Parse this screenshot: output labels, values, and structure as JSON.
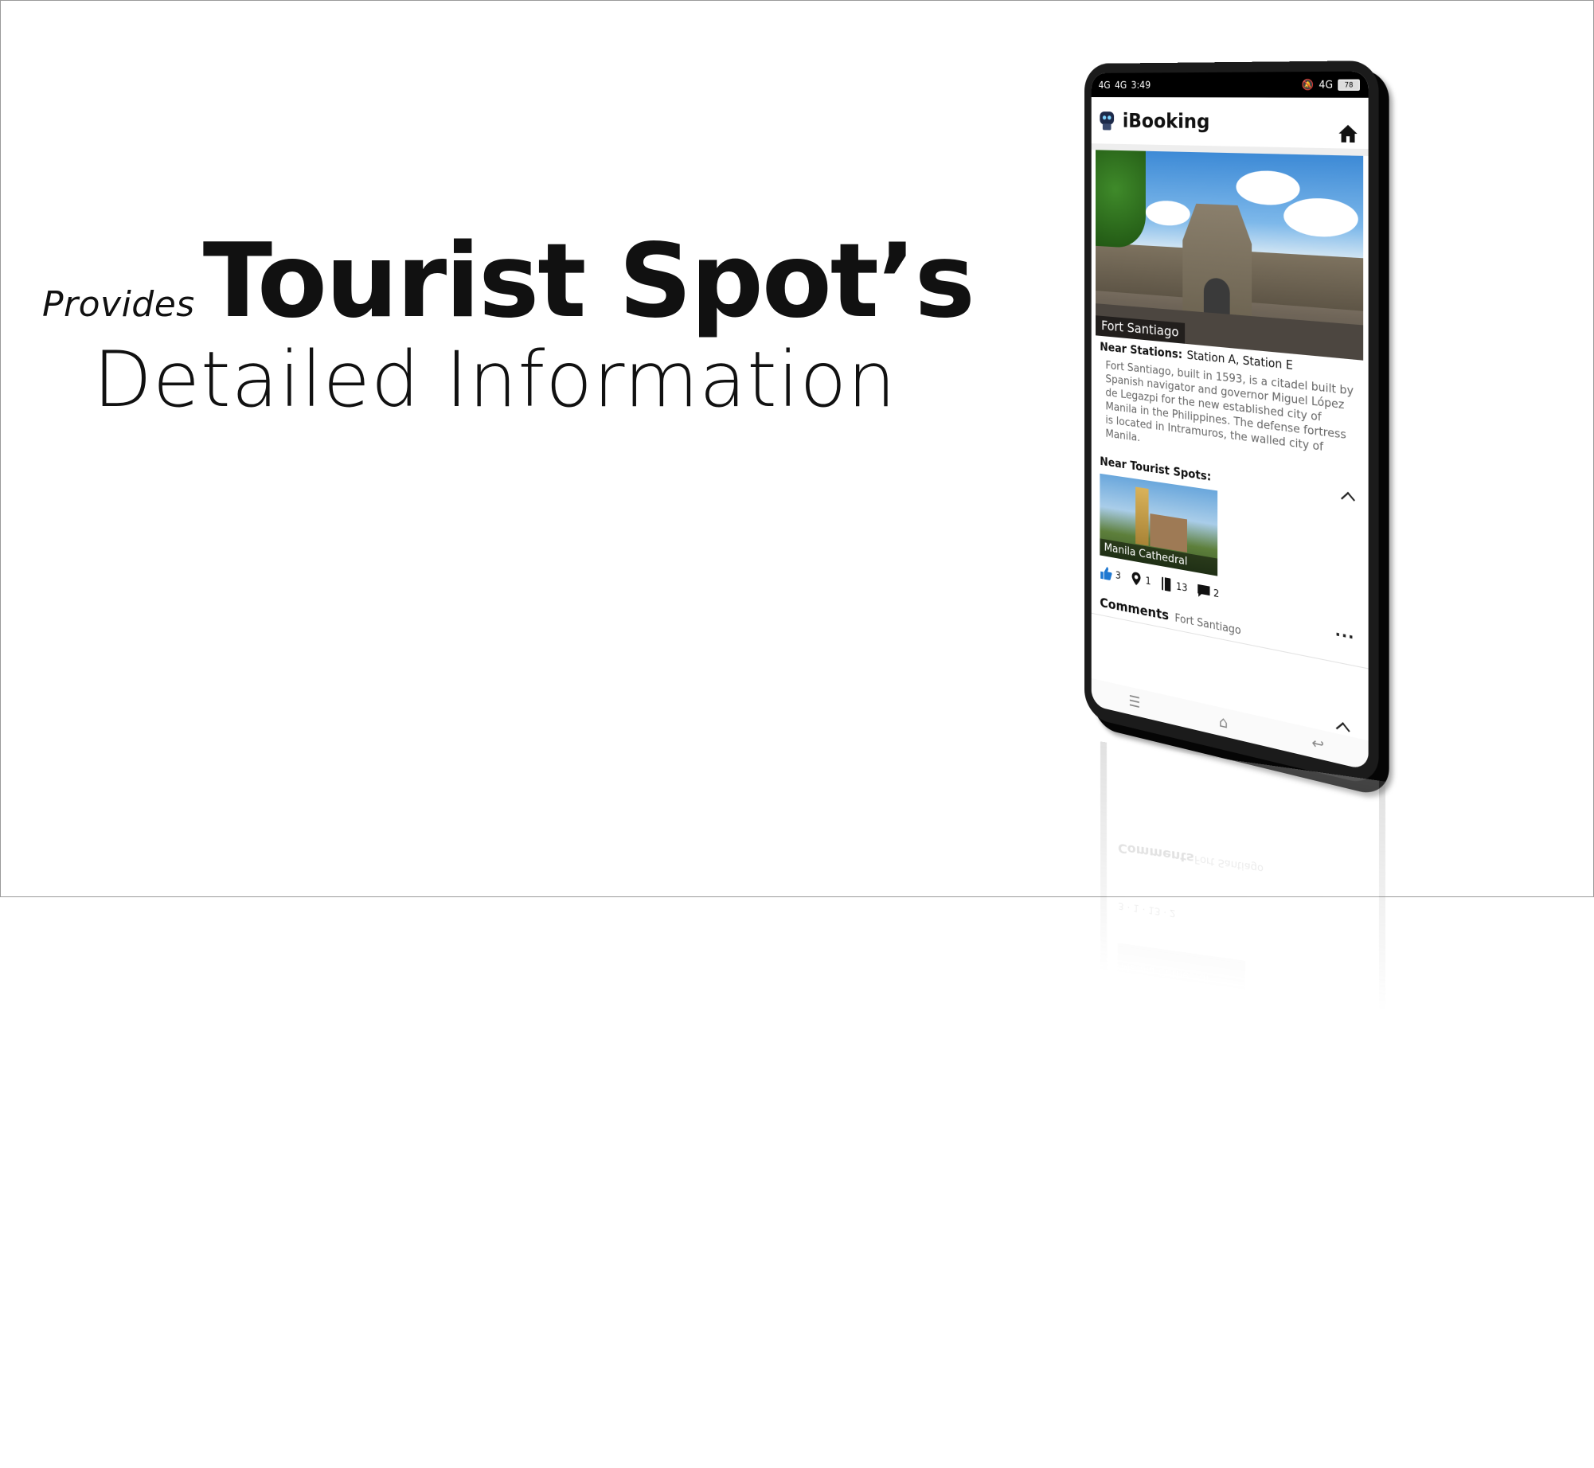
{
  "headline": {
    "provides": "Provides",
    "title": "Tourist Spot’s",
    "subtitle": "Detailed Information"
  },
  "status_bar": {
    "signal_1": "4G",
    "signal_2": "4G",
    "time": "3:49",
    "network_right": "4G",
    "battery": "78"
  },
  "app": {
    "title": "iBooking",
    "logo_icon": "robot-logo-icon",
    "home_icon": "home-icon"
  },
  "spot": {
    "name": "Fort Santiago",
    "near_stations_label": "Near Stations:",
    "near_stations_value": "Station A, Station E",
    "description": "Fort Santiago, built in 1593, is a citadel built by Spanish navigator and governor Miguel López de Legazpi for the new established city of Manila in the Philippines. The defense fortress is located in Intramuros, the walled city of Manila."
  },
  "near_tourist_spots": {
    "label": "Near Tourist Spots:",
    "items": [
      {
        "name": "Manila Cathedral"
      }
    ]
  },
  "stats": {
    "likes": "3",
    "visits": "1",
    "bookmarks": "13",
    "comments": "2",
    "more": "..."
  },
  "comments_section": {
    "title": "Comments",
    "subtitle": "Fort Santiago"
  },
  "colors": {
    "like_blue": "#1f78d1",
    "text_dark": "#111111",
    "text_gray": "#666666"
  }
}
